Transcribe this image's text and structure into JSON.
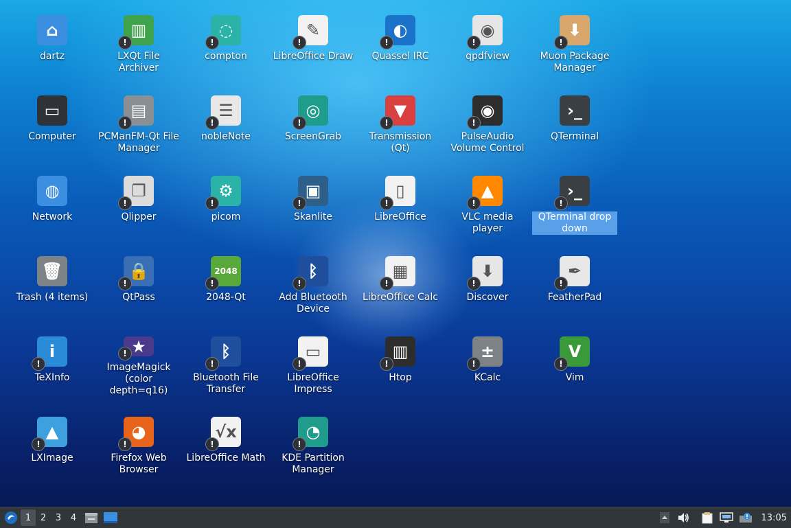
{
  "desktop": {
    "icons": [
      {
        "label": "dartz",
        "name": "folder-home-icon",
        "color": "#3b8ee0",
        "glyph": "⌂",
        "warn": false
      },
      {
        "label": "LXQt File Archiver",
        "name": "archiver-icon",
        "color": "#3fa34d",
        "glyph": "▥",
        "warn": true
      },
      {
        "label": "compton",
        "name": "compton-icon",
        "color": "#2bb3a8",
        "glyph": "◌",
        "warn": true
      },
      {
        "label": "LibreOffice Draw",
        "name": "libreoffice-draw-icon",
        "color": "#f2f2f2",
        "glyph": "✎",
        "warn": true
      },
      {
        "label": "Quassel IRC",
        "name": "quassel-icon",
        "color": "#1a73c9",
        "glyph": "◐",
        "warn": true
      },
      {
        "label": "qpdfview",
        "name": "qpdfview-icon",
        "color": "#e6e6e6",
        "glyph": "◉",
        "warn": true
      },
      {
        "label": "Muon Package Manager",
        "name": "muon-icon",
        "color": "#d9a66b",
        "glyph": "⬇",
        "warn": true
      },
      {
        "label": "Computer",
        "name": "computer-icon",
        "color": "#2f3236",
        "glyph": "▭",
        "warn": false
      },
      {
        "label": "PCManFM-Qt File Manager",
        "name": "file-manager-icon",
        "color": "#8a8f94",
        "glyph": "▤",
        "warn": true
      },
      {
        "label": "nobleNote",
        "name": "noblenote-icon",
        "color": "#e8e8e8",
        "glyph": "☰",
        "warn": true
      },
      {
        "label": "ScreenGrab",
        "name": "screengrab-icon",
        "color": "#1f9c8c",
        "glyph": "◎",
        "warn": true
      },
      {
        "label": "Transmission (Qt)",
        "name": "transmission-icon",
        "color": "#d94040",
        "glyph": "▼",
        "warn": true
      },
      {
        "label": "PulseAudio Volume Control",
        "name": "pulseaudio-icon",
        "color": "#2d2d2d",
        "glyph": "◉",
        "warn": true
      },
      {
        "label": "QTerminal",
        "name": "qterminal-icon",
        "color": "#3a3f44",
        "glyph": "›_",
        "warn": false
      },
      {
        "label": "Network",
        "name": "network-icon",
        "color": "#3b8ee0",
        "glyph": "◍",
        "warn": false
      },
      {
        "label": "Qlipper",
        "name": "qlipper-icon",
        "color": "#dcdcdc",
        "glyph": "❐",
        "warn": true
      },
      {
        "label": "picom",
        "name": "picom-icon",
        "color": "#2bb3a8",
        "glyph": "⚙",
        "warn": true
      },
      {
        "label": "Skanlite",
        "name": "skanlite-icon",
        "color": "#2d5f8a",
        "glyph": "▣",
        "warn": true
      },
      {
        "label": "LibreOffice",
        "name": "libreoffice-icon",
        "color": "#f2f2f2",
        "glyph": "▯",
        "warn": true
      },
      {
        "label": "VLC media player",
        "name": "vlc-icon",
        "color": "#ff8800",
        "glyph": "▲",
        "warn": true
      },
      {
        "label": "QTerminal drop down",
        "name": "qterminal-dropdown-icon",
        "color": "#3a3f44",
        "glyph": "›_",
        "warn": true
      },
      {
        "label": "Trash (4 items)",
        "name": "trash-icon",
        "color": "#7d8286",
        "glyph": "🗑",
        "warn": false
      },
      {
        "label": "QtPass",
        "name": "qtpass-icon",
        "color": "#3b6fb5",
        "glyph": "🔒",
        "warn": true
      },
      {
        "label": "2048-Qt",
        "name": "game-2048-icon",
        "color": "#58a83a",
        "glyph": "2048",
        "warn": true
      },
      {
        "label": "Add Bluetooth Device",
        "name": "bluetooth-icon",
        "color": "#1f4f9c",
        "glyph": "ᛒ",
        "warn": true
      },
      {
        "label": "LibreOffice Calc",
        "name": "libreoffice-calc-icon",
        "color": "#f2f2f2",
        "glyph": "▦",
        "warn": true
      },
      {
        "label": "Discover",
        "name": "discover-icon",
        "color": "#e6e6e6",
        "glyph": "⬇",
        "warn": true
      },
      {
        "label": "FeatherPad",
        "name": "featherpad-icon",
        "color": "#e8e8e8",
        "glyph": "✒",
        "warn": true
      },
      {
        "label": "TeXInfo",
        "name": "info-icon",
        "color": "#2a8bd9",
        "glyph": "i",
        "warn": true
      },
      {
        "label": "ImageMagick (color depth=q16)",
        "name": "imagemagick-icon",
        "color": "#4a3a8c",
        "glyph": "★",
        "warn": true
      },
      {
        "label": "Bluetooth File Transfer",
        "name": "bluetooth-transfer-icon",
        "color": "#1f4f9c",
        "glyph": "ᛒ",
        "warn": true
      },
      {
        "label": "LibreOffice Impress",
        "name": "libreoffice-impress-icon",
        "color": "#f2f2f2",
        "glyph": "▭",
        "warn": true
      },
      {
        "label": "Htop",
        "name": "htop-icon",
        "color": "#2d2d2d",
        "glyph": "▥",
        "warn": true
      },
      {
        "label": "KCalc",
        "name": "kcalc-icon",
        "color": "#7d8286",
        "glyph": "±",
        "warn": true
      },
      {
        "label": "Vim",
        "name": "vim-icon",
        "color": "#3a9a3a",
        "glyph": "V",
        "warn": true
      },
      {
        "label": "LXImage",
        "name": "lximage-icon",
        "color": "#3fa0e0",
        "glyph": "▲",
        "warn": true
      },
      {
        "label": "Firefox Web Browser",
        "name": "firefox-icon",
        "color": "#e8641b",
        "glyph": "◕",
        "warn": true
      },
      {
        "label": "LibreOffice Math",
        "name": "libreoffice-math-icon",
        "color": "#f2f2f2",
        "glyph": "√x",
        "warn": true
      },
      {
        "label": "KDE Partition Manager",
        "name": "partition-manager-icon",
        "color": "#1f9c8c",
        "glyph": "◔",
        "warn": true
      }
    ]
  },
  "taskbar": {
    "desktops": [
      "1",
      "2",
      "3",
      "4"
    ],
    "active_desktop": "1",
    "clock": "13:05"
  }
}
